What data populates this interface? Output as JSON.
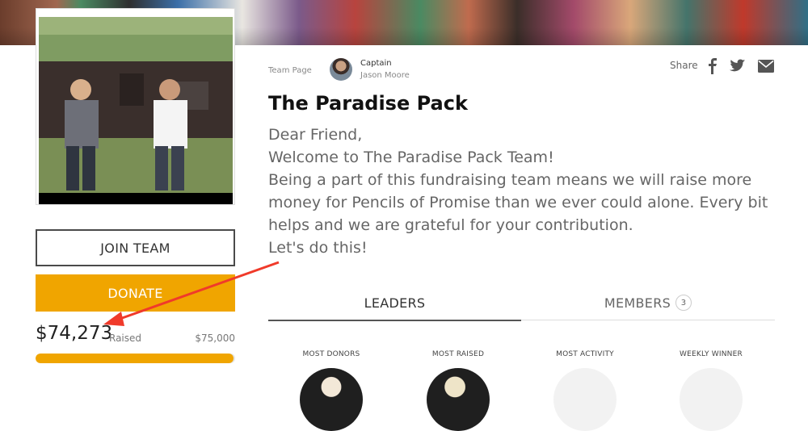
{
  "hero": {
    "description_colors": [
      "#6b3d2c",
      "#4a8a62",
      "#3b6fa8",
      "#7b5a8a",
      "#b8443e",
      "#c0392b"
    ]
  },
  "left": {
    "join_label": "JOIN TEAM",
    "donate_label": "DONATE",
    "raised_amount": "$74,273",
    "raised_label": "Raised",
    "goal_amount": "$75,000",
    "progress_fraction": 0.99,
    "accent_color": "#f0a500"
  },
  "header": {
    "team_page_label": "Team Page",
    "captain_role": "Captain",
    "captain_name": "Jason Moore",
    "share_label": "Share",
    "share_icons": [
      "facebook-icon",
      "twitter-icon",
      "email-icon"
    ]
  },
  "team": {
    "title": "The Paradise Pack",
    "description": [
      "Dear Friend,",
      "Welcome to The Paradise Pack Team!",
      "Being a part of this fundraising team means we will raise more money for Pencils of Promise than we ever could alone. Every bit helps and we are grateful for your contribution.",
      "Let's do this!"
    ]
  },
  "tabs": {
    "leaders_label": "LEADERS",
    "members_label": "MEMBERS",
    "members_count": "3"
  },
  "leaders": {
    "categories": [
      "MOST DONORS",
      "MOST RAISED",
      "MOST ACTIVITY",
      "WEEKLY WINNER"
    ]
  }
}
